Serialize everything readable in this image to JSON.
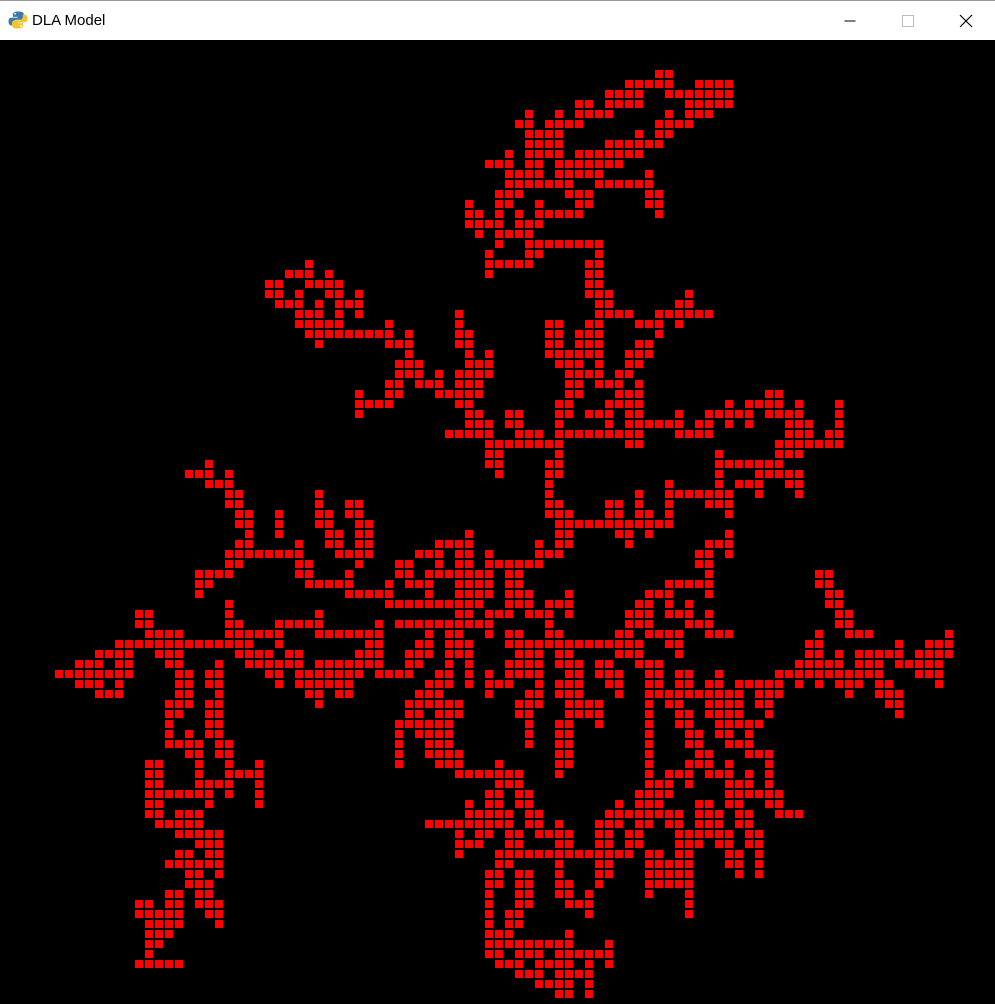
{
  "window": {
    "title": "DLA Model",
    "icon": "python-snake-icon",
    "controls": {
      "minimize": "minimize-icon",
      "maximize": "maximize-icon",
      "close": "close-icon"
    }
  },
  "simulation": {
    "background": "#000000",
    "particle_color": "#ff0000",
    "aggregate_rows": [
      "..............................................................................................................",
      ".................................................................................................................",
      "..................................................###...#...##.......",
      "..................................................#.....#...#....."
    ]
  }
}
